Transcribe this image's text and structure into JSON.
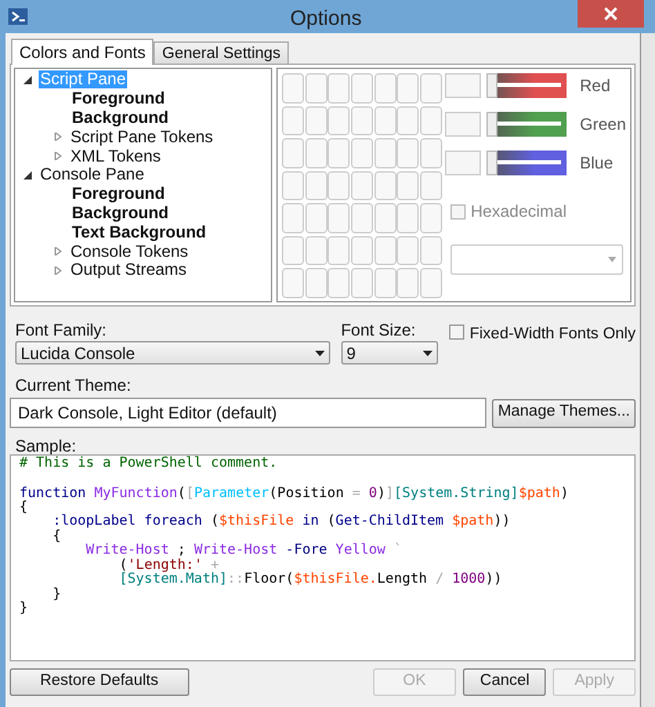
{
  "window": {
    "title": "Options"
  },
  "tabs": [
    {
      "label": "Colors and Fonts",
      "selected": true
    },
    {
      "label": "General Settings",
      "selected": false
    }
  ],
  "tree": [
    {
      "label": "Script Pane",
      "expanded": true,
      "selected": true,
      "children": [
        {
          "label": "Foreground",
          "selected": false
        },
        {
          "label": "Background",
          "selected": false
        },
        {
          "label": "Script Pane Tokens",
          "expanded": false,
          "selected": false
        },
        {
          "label": "XML Tokens",
          "expanded": false,
          "selected": false
        }
      ]
    },
    {
      "label": "Console Pane",
      "expanded": true,
      "selected": false,
      "children": [
        {
          "label": "Foreground",
          "selected": false
        },
        {
          "label": "Background",
          "selected": false
        },
        {
          "label": "Text Background",
          "selected": false
        },
        {
          "label": "Console Tokens",
          "expanded": false,
          "selected": false
        },
        {
          "label": "Output Streams",
          "expanded": false,
          "selected": false
        }
      ]
    }
  ],
  "color_sliders": [
    {
      "label": "Red",
      "color": "#e05050",
      "level": 0
    },
    {
      "label": "Green",
      "color": "#50a050",
      "level": 0
    },
    {
      "label": "Blue",
      "color": "#6060e0",
      "level": 0
    }
  ],
  "hexadecimal": {
    "label": "Hexadecimal",
    "checked": false,
    "disabled": true
  },
  "font_family": {
    "label": "Font Family:",
    "value": "Lucida Console"
  },
  "font_size": {
    "label": "Font Size:",
    "value": "9"
  },
  "fixed_width": {
    "label": "Fixed-Width Fonts Only",
    "checked": false
  },
  "current_theme": {
    "label": "Current Theme:",
    "value": "Dark Console, Light Editor (default)",
    "button": "Manage Themes..."
  },
  "sample": {
    "label": "Sample:",
    "lines": [
      {
        "blank_before": false,
        "tokens": [
          {
            "kind": "comment",
            "text": "# This is a PowerShell comment."
          }
        ]
      },
      {
        "blank_before": true,
        "tokens": [
          {
            "kind": "keyword",
            "text": "function"
          },
          {
            "kind": "command",
            "text": " MyFunction"
          },
          {
            "kind": "plain",
            "text": "("
          },
          {
            "kind": "operator",
            "text": "["
          },
          {
            "kind": "attribute",
            "text": "Parameter"
          },
          {
            "kind": "plain",
            "text": "(Position "
          },
          {
            "kind": "operator",
            "text": "="
          },
          {
            "kind": "number",
            "text": " 0"
          },
          {
            "kind": "plain",
            "text": ")"
          },
          {
            "kind": "operator",
            "text": "]"
          },
          {
            "kind": "type",
            "text": "[System.String]"
          },
          {
            "kind": "variable",
            "text": "$path"
          },
          {
            "kind": "plain",
            "text": ")"
          }
        ]
      },
      {
        "blank_before": false,
        "tokens": [
          {
            "kind": "plain",
            "text": "{"
          }
        ]
      },
      {
        "blank_before": false,
        "tokens": [
          {
            "kind": "keyword",
            "text": "    :loopLabel foreach"
          },
          {
            "kind": "plain",
            "text": " ("
          },
          {
            "kind": "variable",
            "text": "$thisFile"
          },
          {
            "kind": "keyword",
            "text": " in"
          },
          {
            "kind": "plain",
            "text": " ("
          },
          {
            "kind": "keyword",
            "text": "Get-ChildItem"
          },
          {
            "kind": "variable",
            "text": " $path"
          },
          {
            "kind": "plain",
            "text": "))"
          }
        ]
      },
      {
        "blank_before": false,
        "tokens": [
          {
            "kind": "plain",
            "text": "    {"
          }
        ]
      },
      {
        "blank_before": false,
        "tokens": [
          {
            "kind": "command",
            "text": "        Write-Host"
          },
          {
            "kind": "plain",
            "text": " ; "
          },
          {
            "kind": "command",
            "text": "Write-Host"
          },
          {
            "kind": "parameter",
            "text": " -Fore"
          },
          {
            "kind": "argument",
            "text": " Yellow"
          },
          {
            "kind": "operator",
            "text": " `"
          }
        ]
      },
      {
        "blank_before": false,
        "tokens": [
          {
            "kind": "plain",
            "text": "            ("
          },
          {
            "kind": "string",
            "text": "'Length:'"
          },
          {
            "kind": "operator",
            "text": " +"
          }
        ]
      },
      {
        "blank_before": false,
        "tokens": [
          {
            "kind": "type",
            "text": "            [System.Math]"
          },
          {
            "kind": "operator",
            "text": "::"
          },
          {
            "kind": "plain",
            "text": "Floor("
          },
          {
            "kind": "variable",
            "text": "$thisFile."
          },
          {
            "kind": "plain",
            "text": "Length "
          },
          {
            "kind": "operator",
            "text": "/"
          },
          {
            "kind": "number",
            "text": " 1000"
          },
          {
            "kind": "plain",
            "text": "))"
          }
        ]
      },
      {
        "blank_before": false,
        "tokens": [
          {
            "kind": "plain",
            "text": "    }"
          }
        ]
      },
      {
        "blank_before": false,
        "tokens": [
          {
            "kind": "plain",
            "text": "}"
          }
        ]
      }
    ]
  },
  "buttons": [
    {
      "label": "Restore Defaults",
      "disabled": false
    },
    {
      "label": "OK",
      "disabled": true
    },
    {
      "label": "Cancel",
      "disabled": false
    },
    {
      "label": "Apply",
      "disabled": true
    }
  ]
}
